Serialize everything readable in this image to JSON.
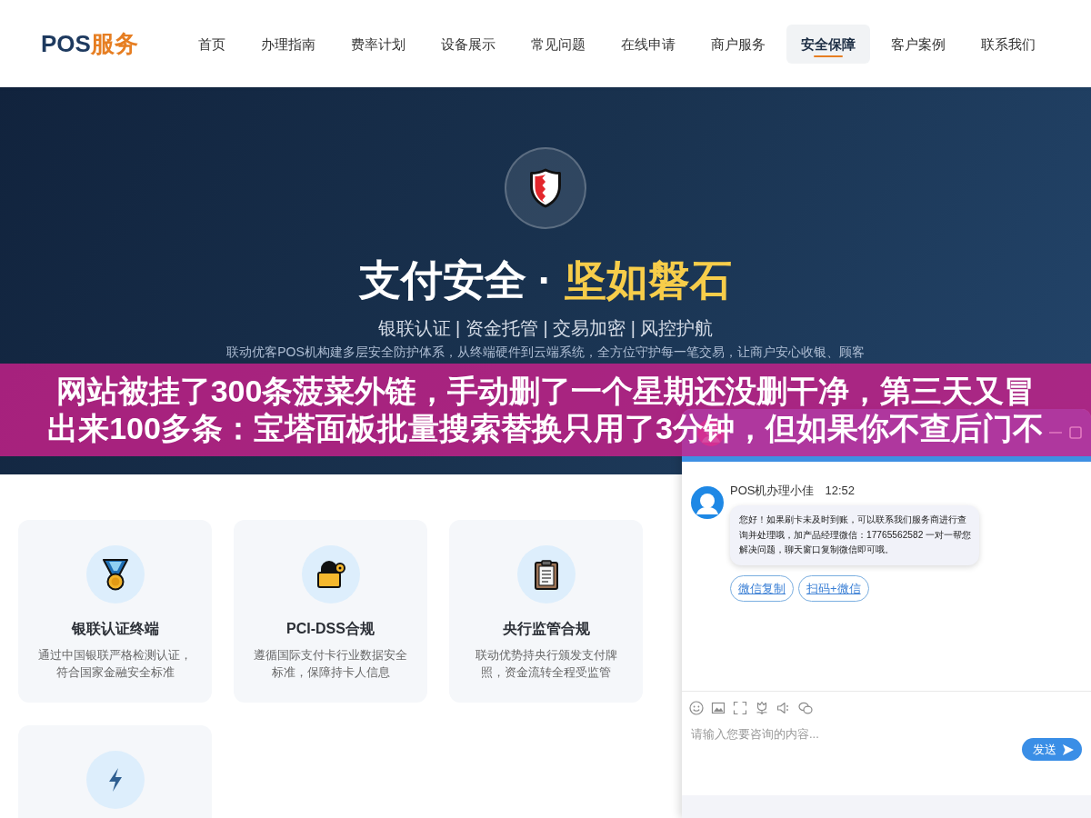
{
  "header": {
    "logo": {
      "brand": "POS",
      "accent": "服务"
    },
    "nav": [
      {
        "label": "首页",
        "selected": false
      },
      {
        "label": "办理指南",
        "selected": false
      },
      {
        "label": "费率计划",
        "selected": false
      },
      {
        "label": "设备展示",
        "selected": false
      },
      {
        "label": "常见问题",
        "selected": false
      },
      {
        "label": "在线申请",
        "selected": false
      },
      {
        "label": "商户服务",
        "selected": false
      },
      {
        "label": "安全保障",
        "selected": true
      },
      {
        "label": "客户案例",
        "selected": false
      },
      {
        "label": "联系我们",
        "selected": false
      }
    ]
  },
  "hero": {
    "title": "支付安全 ·",
    "title_highlight": "坚如磐石",
    "subtitle": "银联认证 | 资金托管 | 交易加密 | 风控护航",
    "description": "联动优客POS机构建多层安全防护体系，从终端硬件到云端系统，全方位守护每一笔交易，让商户安心收银、顾客"
  },
  "features": [
    {
      "kind": "full",
      "title": "银联认证终端",
      "text": "通过中国银联严格检测认证，符合国家金融安全标准"
    },
    {
      "kind": "full",
      "title": "PCI-DSS合规",
      "text": "遵循国际支付卡行业数据安全标准，保障持卡人信息"
    },
    {
      "kind": "full",
      "title": "央行监管合规",
      "text": "联动优势持央行颁发支付牌照，资金流转全程受监管"
    },
    {
      "kind": "partial"
    }
  ],
  "chat": {
    "messages": [
      {
        "sender": "POS机办理小佳",
        "time": "12:52",
        "text": "您好！如果刷卡未及时到账，可以联系我们服务商进行查询并处理哦，加产品经理微信：17765562582 一对一帮您解决问题，聊天窗口复制微信即可哦。",
        "actions": [
          "微信复制",
          "扫码+微信"
        ]
      }
    ],
    "input": {
      "placeholder": "请输入您要咨询的内容..."
    },
    "send_label": "发送"
  },
  "caption": {
    "lines": [
      "网站被挂了300条菠菜外链，手动删了一个星期还没删干净，第三天又冒",
      "出来100多条：宝塔面板批量搜索替换只用了3分钟，但如果你不查后门不"
    ]
  }
}
